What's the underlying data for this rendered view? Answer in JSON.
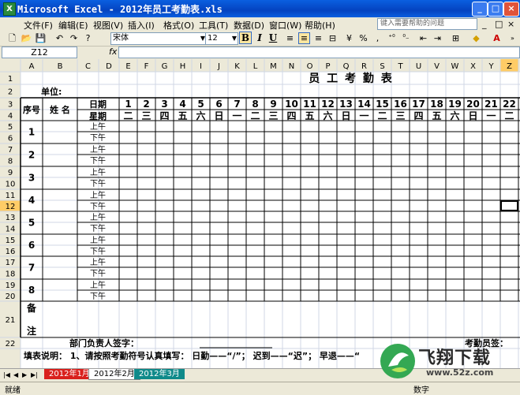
{
  "window": {
    "title": "Microsoft Excel - 2012年员工考勤表.xls",
    "minimize": "_",
    "maximize": "□",
    "close": "×"
  },
  "menu": {
    "items": [
      "文件(F)",
      "编辑(E)",
      "视图(V)",
      "插入(I)",
      "格式(O)",
      "工具(T)",
      "数据(D)",
      "窗口(W)",
      "帮助(H)"
    ],
    "help_placeholder": "键入需要帮助的问题",
    "doc_controls": [
      "_",
      "□",
      "×"
    ]
  },
  "toolbar": {
    "font": "宋体",
    "size": "12",
    "bold": "B",
    "italic": "I",
    "underline": "U",
    "percent": "%",
    "comma": ",",
    "currency": "¥"
  },
  "formula": {
    "cell_ref": "Z12",
    "fx": "fx",
    "value": ""
  },
  "grid": {
    "columns": [
      "A",
      "B",
      "C",
      "D",
      "E",
      "F",
      "G",
      "H",
      "I",
      "J",
      "K",
      "L",
      "M",
      "N",
      "O",
      "P",
      "Q",
      "R",
      "S",
      "T",
      "U",
      "V",
      "W",
      "X",
      "Y",
      "Z"
    ],
    "rows": [
      "1",
      "2",
      "3",
      "4",
      "5",
      "6",
      "7",
      "8",
      "9",
      "10",
      "11",
      "12",
      "13",
      "14",
      "15",
      "16",
      "17",
      "18",
      "19",
      "20",
      "21",
      "22"
    ],
    "active_col": "Z",
    "active_row": "12"
  },
  "table": {
    "title": "员 工 考 勤 表",
    "unit_label": "单位:",
    "seq_header": "序号",
    "name_header": "姓 名",
    "date_label": "日期",
    "weekday_label": "星期",
    "dates": [
      "1",
      "2",
      "3",
      "4",
      "5",
      "6",
      "7",
      "8",
      "9",
      "10",
      "11",
      "12",
      "13",
      "14",
      "15",
      "16",
      "17",
      "18",
      "19",
      "20",
      "21",
      "22"
    ],
    "weekdays": [
      "二",
      "三",
      "四",
      "五",
      "六",
      "日",
      "一",
      "二",
      "三",
      "四",
      "五",
      "六",
      "日",
      "一",
      "二",
      "三",
      "四",
      "五",
      "六",
      "日",
      "一",
      "二"
    ],
    "people": [
      "1",
      "2",
      "3",
      "4",
      "5",
      "6",
      "7",
      "8"
    ],
    "am": "上午",
    "pm": "下午",
    "remarks_top": "备",
    "remarks_bottom": "注",
    "signature": "部门负责人签字：",
    "clerk": "考勤员签：",
    "note": "填表说明：  1、请按照考勤符号认真填写：  日勤——“/”；  迟到——“迟”；  早退——“"
  },
  "sheets": {
    "tabs": [
      "2012年1月",
      "2012年2月",
      "2012年3月"
    ],
    "active": "2012年2月"
  },
  "status": {
    "left": "就绪",
    "right": "数字"
  },
  "watermark": {
    "text": "飞翔下载",
    "url": "www.52z.com"
  }
}
